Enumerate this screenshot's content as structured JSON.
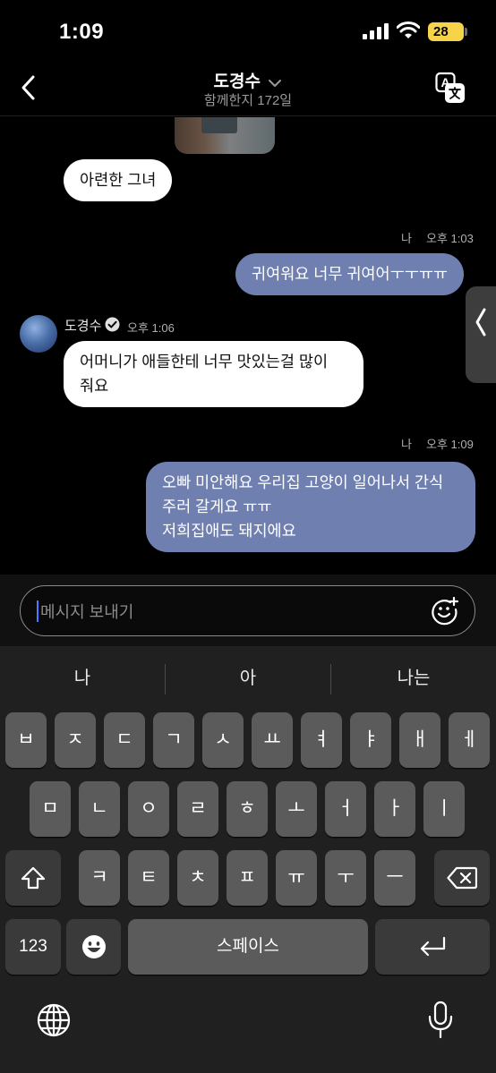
{
  "status_bar": {
    "time": "1:09",
    "battery": "28"
  },
  "header": {
    "title": "도경수",
    "subtitle": "함께한지 172일"
  },
  "messages": [
    {
      "id": "m1",
      "direction": "in",
      "text": "아련한 그녀"
    },
    {
      "id": "m2",
      "direction": "out",
      "sender": "나",
      "time": "오후 1:03",
      "text": "귀여워요 너무 귀여어ㅜㅜㅠㅠ"
    },
    {
      "id": "m3",
      "direction": "in",
      "sender": "도경수",
      "time": "오후 1:06",
      "text_lines": [
        "어머니가 애들한테 너무 맛있는걸 많이",
        "줘요"
      ]
    },
    {
      "id": "m4",
      "direction": "out",
      "sender": "나",
      "time": "오후 1:09",
      "text_lines": [
        "오빠 미안해요 우리집 고양이 일어나서 간식",
        "주러 갈게요 ㅠㅠ",
        "저희집애도 돼지에요"
      ]
    }
  ],
  "composer": {
    "placeholder": "메시지 보내기"
  },
  "keyboard": {
    "suggestions": [
      "나",
      "아",
      "나는"
    ],
    "row1": [
      "ㅂ",
      "ㅈ",
      "ㄷ",
      "ㄱ",
      "ㅅ",
      "ㅛ",
      "ㅕ",
      "ㅑ",
      "ㅐ",
      "ㅔ"
    ],
    "row2": [
      "ㅁ",
      "ㄴ",
      "ㅇ",
      "ㄹ",
      "ㅎ",
      "ㅗ",
      "ㅓ",
      "ㅏ",
      "ㅣ"
    ],
    "row3": [
      "ㅋ",
      "ㅌ",
      "ㅊ",
      "ㅍ",
      "ㅠ",
      "ㅜ",
      "ㅡ"
    ],
    "numbers_label": "123",
    "space_label": "스페이스"
  },
  "colors": {
    "outgoing_bubble": "#6f7fb0",
    "incoming_bubble": "#ffffff",
    "battery": "#f7d34a",
    "caret": "#4a7bff"
  },
  "icons": [
    "back-icon",
    "chevron-down-icon",
    "translate-icon",
    "verified-icon",
    "emoji-add-icon",
    "shift-icon",
    "backspace-icon",
    "emoji-icon",
    "return-icon",
    "globe-icon",
    "mic-icon"
  ]
}
